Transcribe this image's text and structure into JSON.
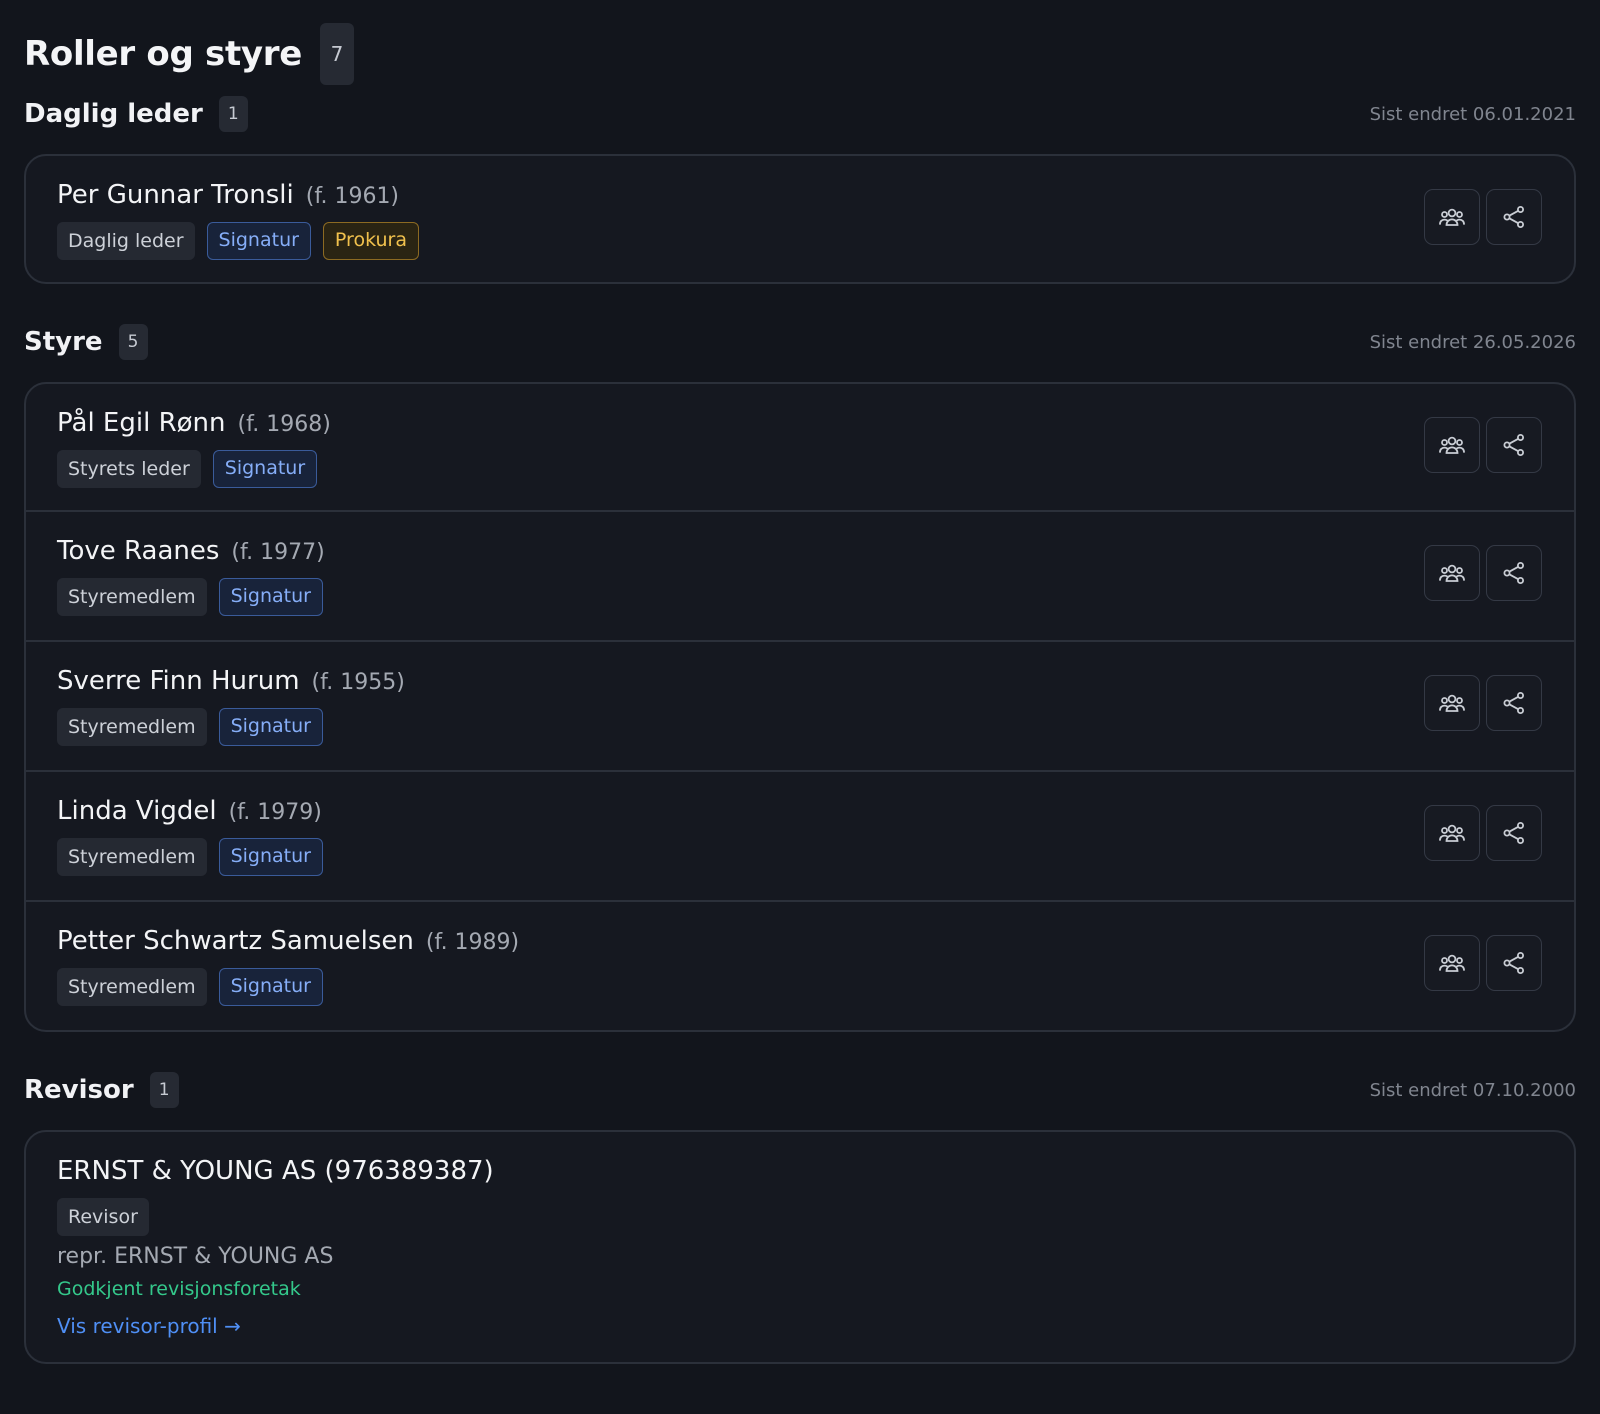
{
  "header": {
    "title": "Roller og styre",
    "count": "7"
  },
  "sections": [
    {
      "title": "Daglig leder",
      "count": "1",
      "updated": "Sist endret 06.01.2021",
      "people": [
        {
          "name": "Per Gunnar Tronsli",
          "birth": "(f. 1961)",
          "role": "Daglig leder",
          "signatur": "Signatur",
          "prokura": "Prokura"
        }
      ]
    },
    {
      "title": "Styre",
      "count": "5",
      "updated": "Sist endret 26.05.2026",
      "people": [
        {
          "name": "Pål Egil Rønn",
          "birth": "(f. 1968)",
          "role": "Styrets leder",
          "signatur": "Signatur"
        },
        {
          "name": "Tove Raanes",
          "birth": "(f. 1977)",
          "role": "Styremedlem",
          "signatur": "Signatur"
        },
        {
          "name": "Sverre Finn Hurum",
          "birth": "(f. 1955)",
          "role": "Styremedlem",
          "signatur": "Signatur"
        },
        {
          "name": "Linda Vigdel",
          "birth": "(f. 1979)",
          "role": "Styremedlem",
          "signatur": "Signatur"
        },
        {
          "name": "Petter Schwartz Samuelsen",
          "birth": "(f. 1989)",
          "role": "Styremedlem",
          "signatur": "Signatur"
        }
      ]
    },
    {
      "title": "Revisor",
      "count": "1",
      "updated": "Sist endret 07.10.2000",
      "auditor": {
        "name": "ERNST & YOUNG AS (976389387)",
        "role": "Revisor",
        "representative": "repr. ERNST & YOUNG AS",
        "approved": "Godkjent revisjonsforetak",
        "link": "Vis revisor-profil →"
      }
    }
  ],
  "icons": {
    "group": "people-group-icon",
    "share": "share-icon"
  },
  "colors": {
    "signatur": "#86aef8",
    "prokura": "#f1c14d",
    "approved": "#34c88b",
    "link": "#4f8ff5"
  }
}
